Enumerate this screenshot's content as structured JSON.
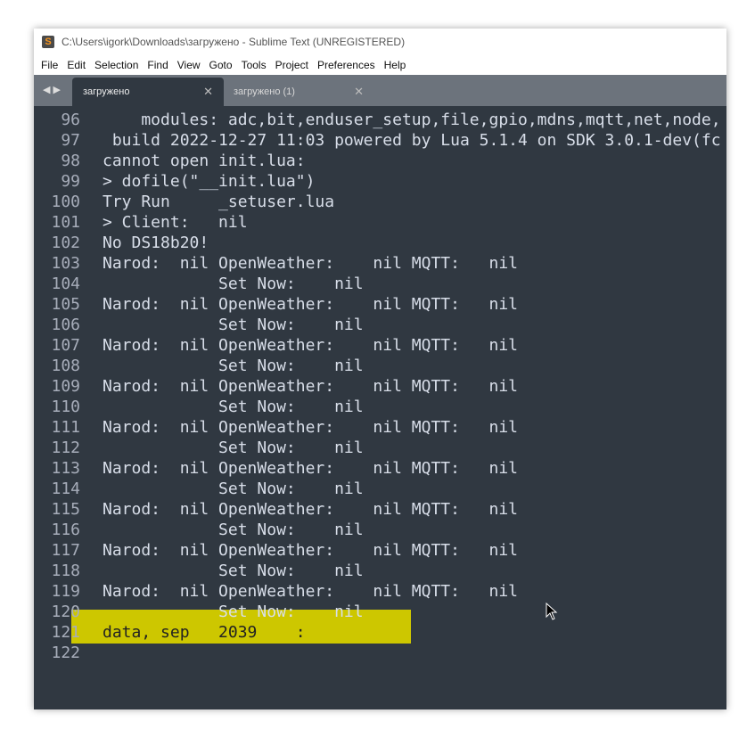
{
  "window": {
    "title": "C:\\Users\\igork\\Downloads\\загружено - Sublime Text (UNREGISTERED)"
  },
  "menu": [
    "File",
    "Edit",
    "Selection",
    "Find",
    "View",
    "Goto",
    "Tools",
    "Project",
    "Preferences",
    "Help"
  ],
  "tabs": [
    {
      "label": "загружено",
      "active": true
    },
    {
      "label": "загружено (1)",
      "active": false
    }
  ],
  "highlight_color": "#cdc700",
  "lines": [
    {
      "n": "96",
      "t": "    modules: adc,bit,enduser_setup,file,gpio,mdns,mqtt,net,node,"
    },
    {
      "n": "97",
      "t": " build 2022-12-27 11:03 powered by Lua 5.1.4 on SDK 3.0.1-dev(fc"
    },
    {
      "n": "98",
      "t": "cannot open init.lua:"
    },
    {
      "n": "99",
      "t": "> dofile(\"__init.lua\")"
    },
    {
      "n": "100",
      "t": "Try Run     _setuser.lua"
    },
    {
      "n": "101",
      "t": "> Client:   nil"
    },
    {
      "n": "102",
      "t": "No DS18b20!"
    },
    {
      "n": "103",
      "t": "Narod:  nil OpenWeather:    nil MQTT:   nil"
    },
    {
      "n": "104",
      "t": "            Set Now:    nil"
    },
    {
      "n": "105",
      "t": "Narod:  nil OpenWeather:    nil MQTT:   nil"
    },
    {
      "n": "106",
      "t": "            Set Now:    nil"
    },
    {
      "n": "107",
      "t": "Narod:  nil OpenWeather:    nil MQTT:   nil"
    },
    {
      "n": "108",
      "t": "            Set Now:    nil"
    },
    {
      "n": "109",
      "t": "Narod:  nil OpenWeather:    nil MQTT:   nil"
    },
    {
      "n": "110",
      "t": "            Set Now:    nil"
    },
    {
      "n": "111",
      "t": "Narod:  nil OpenWeather:    nil MQTT:   nil"
    },
    {
      "n": "112",
      "t": "            Set Now:    nil"
    },
    {
      "n": "113",
      "t": "Narod:  nil OpenWeather:    nil MQTT:   nil"
    },
    {
      "n": "114",
      "t": "            Set Now:    nil"
    },
    {
      "n": "115",
      "t": "Narod:  nil OpenWeather:    nil MQTT:   nil"
    },
    {
      "n": "116",
      "t": "            Set Now:    nil"
    },
    {
      "n": "117",
      "t": "Narod:  nil OpenWeather:    nil MQTT:   nil"
    },
    {
      "n": "118",
      "t": "            Set Now:    nil"
    },
    {
      "n": "119",
      "t": "Narod:  nil OpenWeather:    nil MQTT:   nil"
    },
    {
      "n": "120",
      "t": "            Set Now:    nil"
    },
    {
      "n": "121",
      "t": "data, sep   2039    :"
    },
    {
      "n": "122",
      "t": ""
    }
  ]
}
